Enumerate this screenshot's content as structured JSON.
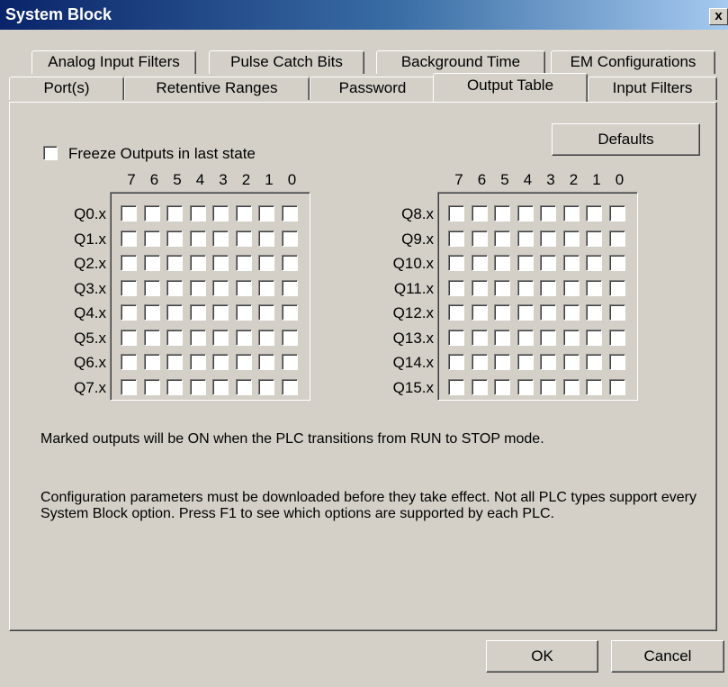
{
  "window": {
    "title": "System Block",
    "close_label": "x"
  },
  "tabs_back": [
    "Analog Input Filters",
    "Pulse Catch Bits",
    "Background Time",
    "EM Configurations"
  ],
  "tabs_front": [
    "Port(s)",
    "Retentive Ranges",
    "Password",
    "Output Table",
    "Input Filters"
  ],
  "active_tab": "Output Table",
  "freeze": {
    "label": "Freeze Outputs in last state",
    "checked": false
  },
  "defaults_label": "Defaults",
  "bit_headers": [
    "7",
    "6",
    "5",
    "4",
    "3",
    "2",
    "1",
    "0"
  ],
  "left_rows": [
    "Q0.x",
    "Q1.x",
    "Q2.x",
    "Q3.x",
    "Q4.x",
    "Q5.x",
    "Q6.x",
    "Q7.x"
  ],
  "right_rows": [
    "Q8.x",
    "Q9.x",
    "Q10.x",
    "Q11.x",
    "Q12.x",
    "Q13.x",
    "Q14.x",
    "Q15.x"
  ],
  "notes": {
    "marked": "Marked outputs will be ON when the PLC transitions from RUN to STOP mode.",
    "config": "Configuration parameters must be downloaded before they take effect. Not all PLC types support every System Block option. Press F1 to see which options are supported by each PLC."
  },
  "footer": {
    "ok_label": "OK",
    "cancel_label": "Cancel"
  }
}
